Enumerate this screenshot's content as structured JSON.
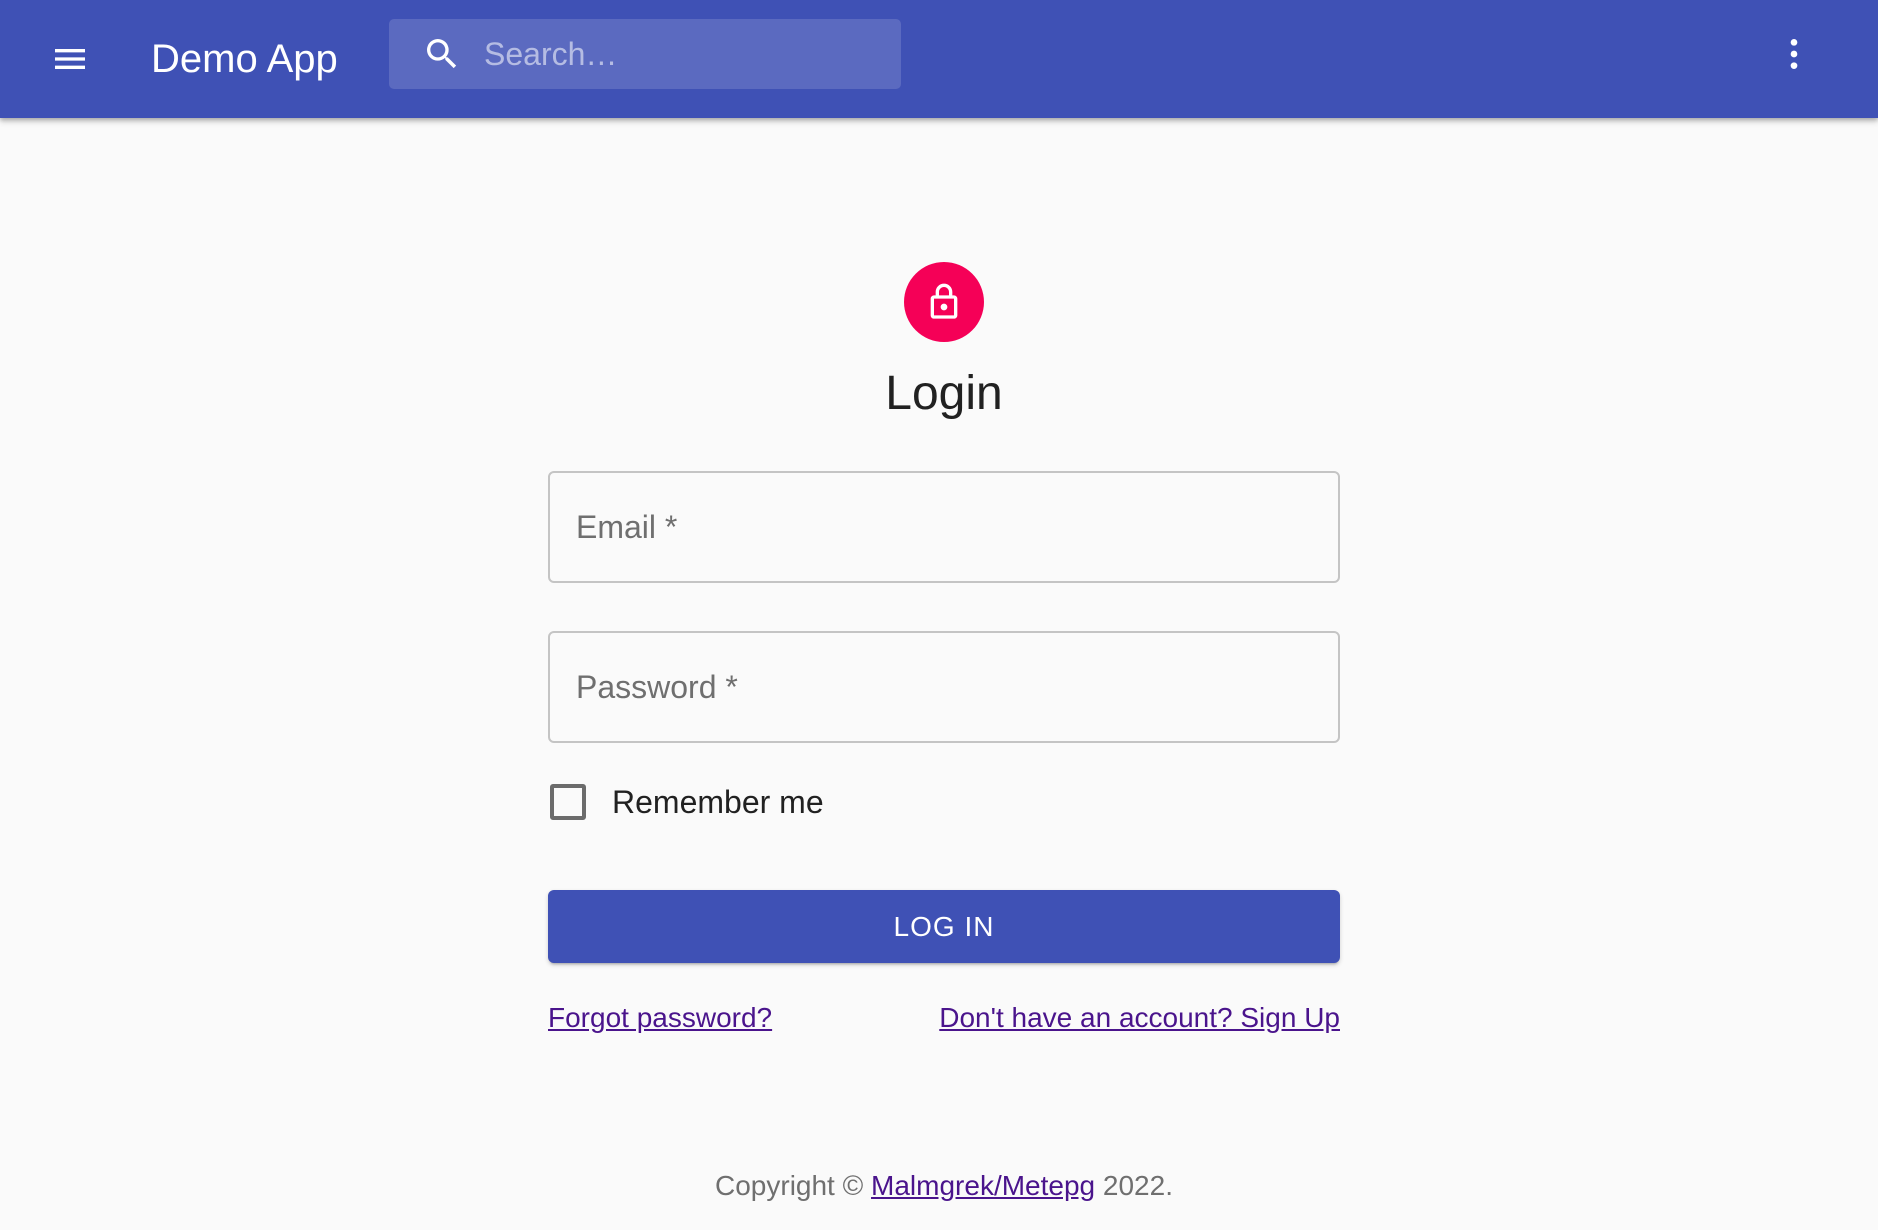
{
  "header": {
    "app_title": "Demo App",
    "menu_icon": "hamburger-menu-icon",
    "search": {
      "icon": "search-icon",
      "placeholder": "Search…",
      "value": ""
    },
    "more_icon": "more-vertical-icon"
  },
  "login": {
    "avatar_icon": "lock-icon",
    "avatar_color": "#f50057",
    "title": "Login",
    "email": {
      "placeholder": "Email *",
      "value": ""
    },
    "password": {
      "placeholder": "Password *",
      "value": ""
    },
    "remember_me": {
      "label": "Remember me",
      "checked": false
    },
    "submit_label": "LOG IN",
    "forgot_password_link": "Forgot password?",
    "signup_link": "Don't have an account? Sign Up"
  },
  "footer": {
    "copyright_prefix": "Copyright © ",
    "owner_link": "Malmgrek/Metepg",
    "copyright_suffix": " 2022."
  },
  "colors": {
    "primary": "#3f51b5",
    "secondary": "#f50057",
    "link": "#4a148c",
    "background": "#fafafa"
  }
}
